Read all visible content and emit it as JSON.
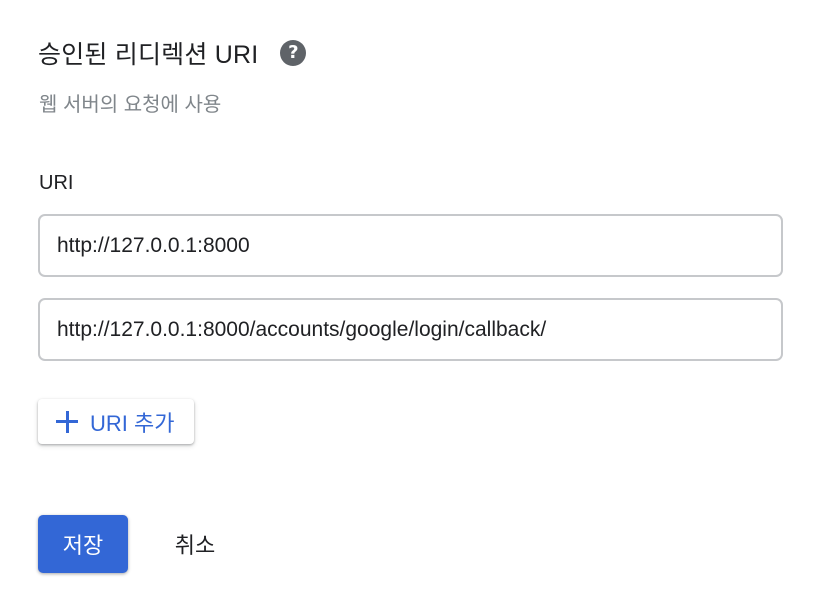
{
  "section": {
    "title": "승인된 리디렉션 URI",
    "help_icon": "help-icon",
    "subtitle": "웹 서버의 요청에 사용"
  },
  "uri_field": {
    "label": "URI",
    "values": [
      "http://127.0.0.1:8000",
      "http://127.0.0.1:8000/accounts/google/login/callback/"
    ]
  },
  "add_uri": {
    "icon": "plus-icon",
    "label": "URI 추가"
  },
  "actions": {
    "save_label": "저장",
    "cancel_label": "취소"
  },
  "colors": {
    "accent": "#3367d6",
    "text": "#202124",
    "muted_text": "#80868b",
    "border": "#c6c8cb"
  }
}
